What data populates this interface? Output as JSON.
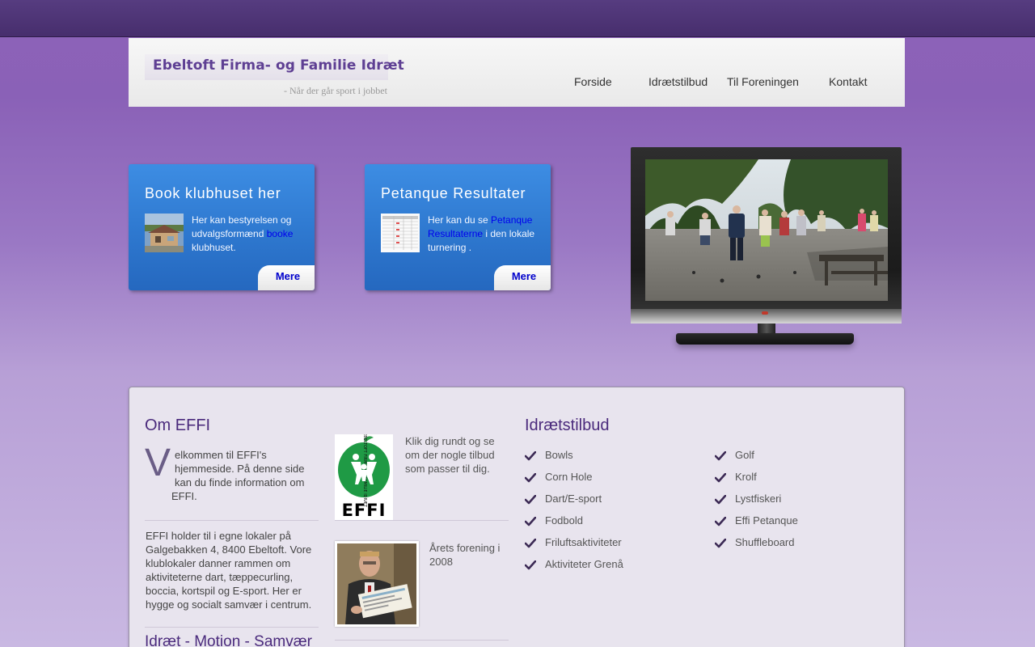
{
  "header": {
    "title": "Ebeltoft Firma- og Familie Idræt",
    "subtitle": "- Når der går sport i jobbet",
    "nav": [
      "Forside",
      "Idrætstilbud",
      "Til Foreningen",
      "Kontakt"
    ]
  },
  "cards": [
    {
      "title": "Book klubhuset her",
      "text_before": "Her kan bestyrelsen og udvalgsformænd ",
      "link": "booke",
      "text_after": " klubhuset.",
      "more": "Mere"
    },
    {
      "title": "Petanque Resultater",
      "text_before": "Her kan du se ",
      "link": "Petanque Resultaterne",
      "text_after": " i den lokale turnering .",
      "more": "Mere"
    }
  ],
  "about": {
    "heading": "Om EFFI",
    "dropcap": "V",
    "welcome_lines": [
      "elkommen til EFFI's",
      "hjemmeside. På denne side",
      "kan du finde information om",
      "EFFI."
    ],
    "paragraph": "EFFI holder til i egne lokaler på Galgebakken 4, 8400 Ebeltoft. Vore klublokaler danner rammen om aktiviteterne dart, tæppecurling, boccia, kortspil og E-sport. Her er hygge og socialt samvær i centrum.",
    "heading2": "Idræt - Motion - Samvær"
  },
  "middle": {
    "logo_text": "EFFI",
    "logo_ring": "EBELTOFT FIRMA- OG FAMILIE IDRÆT",
    "intro": "Klik dig rundt og se om der nogle tilbud som passer til dig.",
    "award": "Årets forening i 2008"
  },
  "offers": {
    "heading": "Idrætstilbud",
    "col1": [
      "Bowls",
      "Corn Hole",
      "Dart/E-sport",
      "Fodbold",
      "Friluftsaktiviteter",
      "Aktiviteter Grenå"
    ],
    "col2": [
      "Golf",
      "Krolf",
      "Lystfiskeri",
      "Effi Petanque",
      "Shuffleboard"
    ]
  },
  "colors": {
    "accent_purple": "#4a2a7c",
    "card_blue": "#2e78cf",
    "link_blue": "#0000ee"
  }
}
